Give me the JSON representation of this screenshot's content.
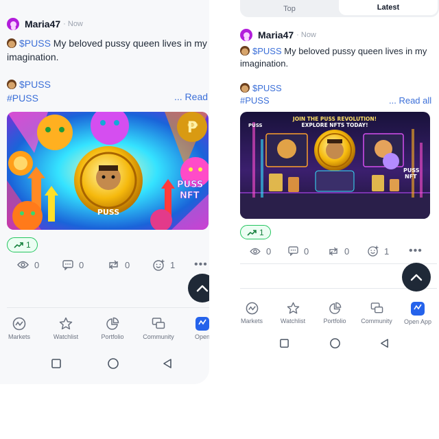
{
  "left": {
    "post": {
      "username": "Maria47",
      "time": "· Now",
      "line1_ticker": "$PUSS",
      "line1_text": " My beloved pussy queen lives in my imagination.",
      "line2_ticker": "$PUSS",
      "hashtag": "#PUSS",
      "read_more": "... Read",
      "image_text_coin": "PUSS",
      "image_text_nft": "PUSS\nNFT"
    },
    "trend_count": "1",
    "stats": {
      "views": "0",
      "comments": "0",
      "reposts": "0",
      "likes": "1"
    },
    "nav": [
      "Markets",
      "Watchlist",
      "Portfolio",
      "Community",
      "Open"
    ]
  },
  "right": {
    "tabs": [
      "Top",
      "Latest"
    ],
    "post": {
      "username": "Maria47",
      "time": "· Now",
      "line1_ticker": "$PUSS",
      "line1_text": " My beloved pussy queen lives in my imagination.",
      "line2_ticker": "$PUSS",
      "hashtag": "#PUSS",
      "read_more": "... Read all",
      "image_banner": "JOIN THE PUSS REVOLUTION!\nEXPLORE NFTS TODAY!",
      "image_text_nft": "PUSS\nNFT"
    },
    "trend_count": "1",
    "stats": {
      "views": "0",
      "comments": "0",
      "reposts": "0",
      "likes": "1"
    },
    "nav": [
      "Markets",
      "Watchlist",
      "Portfolio",
      "Community",
      "Open App"
    ]
  },
  "colors": {
    "accent": "#3b6fd8",
    "trend": "#22c55e",
    "avatar": "#b21ddb",
    "dark_button": "#1f2937"
  },
  "icons": [
    "eye-icon",
    "comment-icon",
    "repost-icon",
    "like-icon",
    "more-icon",
    "arrow-up-icon",
    "markets-icon",
    "star-icon",
    "portfolio-icon",
    "community-icon",
    "open-app-icon",
    "square-icon",
    "circle-icon",
    "back-icon"
  ]
}
